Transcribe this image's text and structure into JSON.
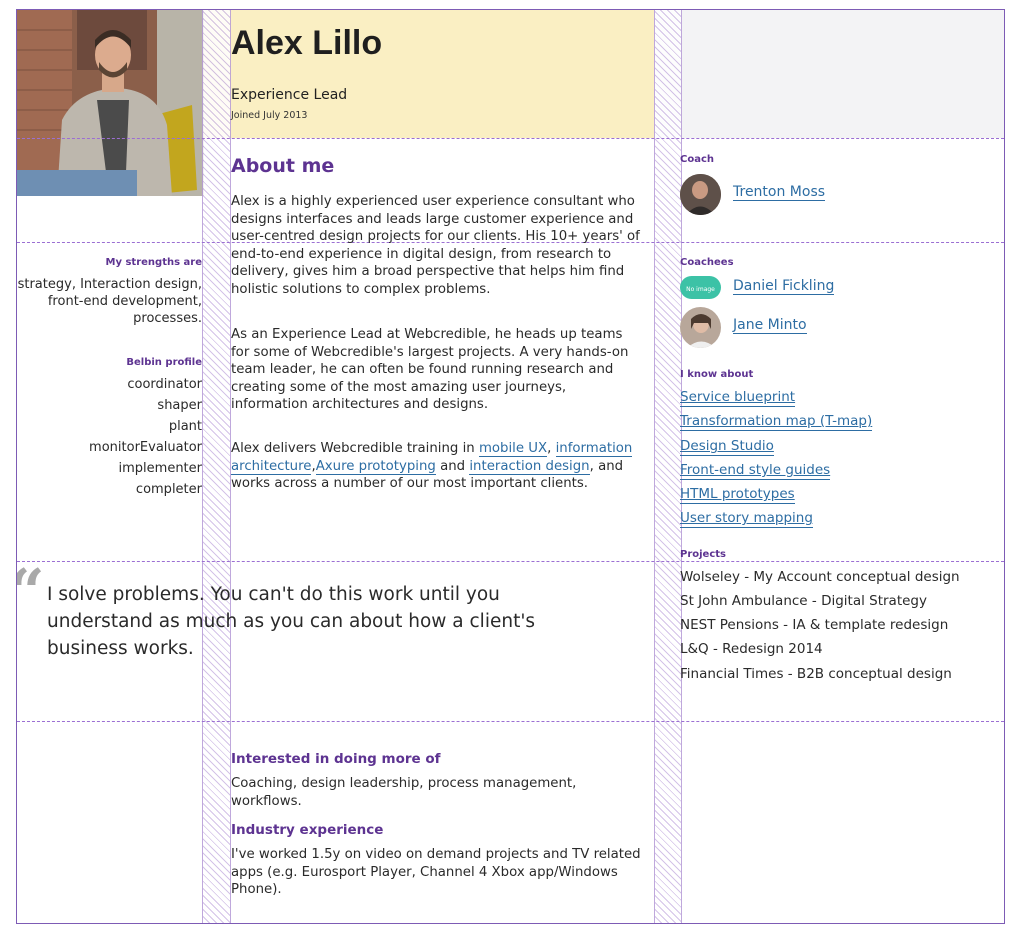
{
  "profile": {
    "name": "Alex Lillo",
    "role": "Experience Lead",
    "joined": "Joined July 2013"
  },
  "about": {
    "heading": "About me",
    "p1": "Alex is a highly experienced user experience consultant who designs interfaces and leads large customer experience and user-centred design projects for our clients. His 10+ years' of end-to-end experience in digital design, from research to delivery, gives him a broad perspective that helps him find holistic solutions to complex problems.",
    "p2": "As an Experience Lead at Webcredible, he heads up teams for some of Webcredible's largest projects. A very hands-on team leader, he can often be found running research and creating some of the most amazing user journeys, information architectures and designs.",
    "p3_start": "Alex delivers Webcredible training in ",
    "link_mobile": "mobile UX",
    "p3_comma1": ", ",
    "link_ia": "information architecture",
    "p3_comma2": ",",
    "link_axure": "Axure prototyping",
    "p3_and": " and ",
    "link_id": "interaction design",
    "p3_end": ", and works across a number of our most important clients."
  },
  "strengths": {
    "label": "My strengths are",
    "text": "strategy, Interaction design, front-end development, processes."
  },
  "belbin": {
    "label": "Belbin profile",
    "items": [
      "coordinator",
      "shaper",
      "plant",
      "monitorEvaluator",
      "implementer",
      "completer"
    ]
  },
  "social": {
    "icons": [
      "twitter-icon",
      "linkedin-icon",
      "globe-icon"
    ]
  },
  "coach": {
    "label": "Coach",
    "name": "Trenton Moss"
  },
  "coachees": {
    "label": "Coachees",
    "items": [
      {
        "name": "Daniel Fickling",
        "avatar_text": "No image"
      },
      {
        "name": "Jane Minto"
      }
    ]
  },
  "know_about": {
    "label": "I know about",
    "items": [
      "Service blueprint",
      "Transformation map (T-map)",
      "Design Studio",
      "Front-end style guides",
      "HTML prototypes",
      "User story mapping"
    ]
  },
  "projects": {
    "label": "Projects",
    "items": [
      "Wolseley - My Account conceptual design",
      "St John Ambulance - Digital Strategy",
      "NEST Pensions - IA & template redesign",
      "L&Q - Redesign 2014",
      "Financial Times - B2B conceptual design"
    ]
  },
  "quote": {
    "mark": "“",
    "text": "I solve problems. You can't do this work until you understand as much as you can about how a client's business works."
  },
  "interested": {
    "heading": "Interested in doing more of",
    "text": "Coaching, design leadership, process management, workflows."
  },
  "industry": {
    "heading": "Industry experience",
    "text": "I've worked 1.5y on video on demand projects and TV related apps (e.g. Eurosport Player, Channel 4 Xbox app/Windows Phone)."
  },
  "colors": {
    "accent_purple": "#5d3391",
    "link_blue": "#2d6da3",
    "header_yellow": "#faefc3"
  }
}
